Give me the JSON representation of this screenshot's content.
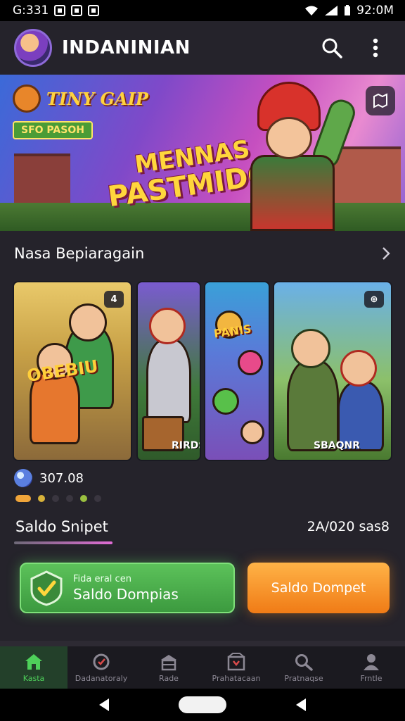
{
  "status_bar": {
    "time": "G:331",
    "clock_right": "92:0M"
  },
  "app_bar": {
    "title": "INDANINIAN"
  },
  "banner": {
    "brand": "TINY GAIP",
    "tag": "SFO PASOH",
    "headline_line1": "MENNAS",
    "headline_line2": "PASTMIDO!"
  },
  "section": {
    "title": "Nasa Bepiaragain"
  },
  "cards": [
    {
      "sign": "OBEBIU",
      "badge": "4",
      "label": ""
    },
    {
      "sign": "",
      "badge": "",
      "label": "RIRDS"
    },
    {
      "sign": "PANIS",
      "badge": "",
      "label": ""
    },
    {
      "sign": "",
      "badge": "⊕",
      "label": "SBAQNR"
    }
  ],
  "coin": {
    "amount": "307.08"
  },
  "saldo": {
    "title": "Saldo Snipet",
    "amount": "2A/020 sas8"
  },
  "buttons": {
    "green_small": "Fida eral cen",
    "green_big": "Saldo Dompias",
    "orange": "Saldo Dompet"
  },
  "bottom_nav": [
    {
      "label": "Kasta",
      "icon": "home-icon",
      "active": true
    },
    {
      "label": "Dadanatoraly",
      "icon": "shield-icon",
      "active": false
    },
    {
      "label": "Rade",
      "icon": "store-icon",
      "active": false
    },
    {
      "label": "Prahatacaan",
      "icon": "box-icon",
      "active": false
    },
    {
      "label": "Pratnaqse",
      "icon": "search-icon",
      "active": false
    },
    {
      "label": "Frntle",
      "icon": "profile-icon",
      "active": false
    }
  ],
  "colors": {
    "accent_green": "#4ed05a",
    "accent_orange": "#f07b16",
    "background": "#25232b",
    "nav_background": "#1b1a20"
  }
}
